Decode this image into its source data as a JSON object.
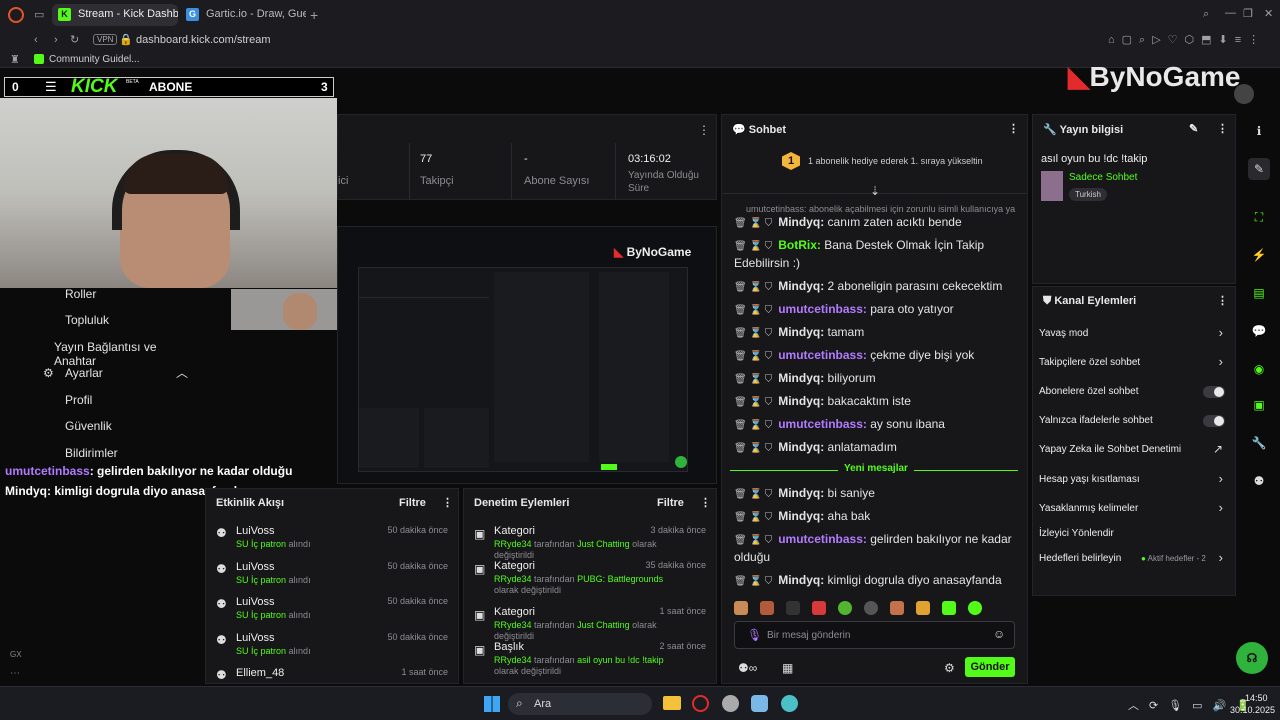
{
  "browser": {
    "tabs": [
      {
        "label": "Stream - Kick Dashboard",
        "active": true
      },
      {
        "label": "Gartic.io - Draw, Guess, W",
        "active": false
      }
    ],
    "url": "dashboard.kick.com/stream",
    "vpn": "VPN",
    "bookmark": "Community Guidel..."
  },
  "overlay": {
    "kick_logo": "KICK",
    "beta": "BETA",
    "abone_label": "ABONE",
    "abone_count": "3",
    "zero": "0",
    "brand": "ByNoGame"
  },
  "left_menu": {
    "items": [
      "Roller",
      "Topluluk",
      "Yayın Bağlantısı ve Anahtar",
      "Ayarlar",
      "Profil",
      "Güvenlik",
      "Bildirimler"
    ],
    "gx": "GX"
  },
  "overlay_chat": [
    {
      "user": "umutcetinbass",
      "text": ": gelirden bakılıyor ne kadar olduğu"
    },
    {
      "user": "Mindyq",
      "text": ": kimligi dogrula diyo anasayfanda"
    }
  ],
  "stats": [
    {
      "value": "",
      "label": "ici"
    },
    {
      "value": "77",
      "label": "Takipçi"
    },
    {
      "value": "-",
      "label": "Abone Sayısı"
    },
    {
      "value": "03:16:02",
      "label": "Yayında Olduğu Süre"
    }
  ],
  "activity": {
    "title": "Etkinlik Akışı",
    "filter": "Filtre",
    "items": [
      {
        "user": "LuiVoss",
        "detail": "SU İç patron",
        "suffix": "alındı",
        "time": "50 dakika önce"
      },
      {
        "user": "LuiVoss",
        "detail": "SU İç patron",
        "suffix": "alındı",
        "time": "50 dakika önce"
      },
      {
        "user": "LuiVoss",
        "detail": "SU İç patron",
        "suffix": "alındı",
        "time": "50 dakika önce"
      },
      {
        "user": "LuiVoss",
        "detail": "SU İç patron",
        "suffix": "alındı",
        "time": "50 dakika önce"
      },
      {
        "user": "Elliem_48",
        "detail": "",
        "suffix": "",
        "time": "1 saat önce"
      }
    ]
  },
  "moderation": {
    "title": "Denetim Eylemleri",
    "filter": "Filtre",
    "items": [
      {
        "title": "Kategori",
        "time": "3 dakika önce",
        "actor": "RRyde34",
        "mid": "tarafından",
        "value": "Just Chatting",
        "rest": "olarak değiştirildi"
      },
      {
        "title": "Kategori",
        "time": "35 dakika önce",
        "actor": "RRyde34",
        "mid": "tarafından",
        "value": "PUBG: Battlegrounds",
        "rest": "olarak değiştirildi"
      },
      {
        "title": "Kategori",
        "time": "1 saat önce",
        "actor": "RRyde34",
        "mid": "tarafından",
        "value": "Just Chatting",
        "rest": "olarak değiştirildi"
      },
      {
        "title": "Başlık",
        "time": "2 saat önce",
        "actor": "RRyde34",
        "mid": "tarafından",
        "value": "asil oyun bu !dc !takip",
        "rest": "olarak değiştirildi"
      }
    ]
  },
  "chat": {
    "title": "Sohbet",
    "pinned_badge": "1",
    "pinned": "1 abonelik hediye ederek 1. sıraya yükseltin",
    "system_line": "umutcetinbass: abonelik açabilmesi için zorunlu isimli kullanıcıya ya...",
    "messages": [
      {
        "user": "Mindyq",
        "text": "canım zaten acıktı bende",
        "color": "#e4e4e4"
      },
      {
        "user": "BotRix",
        "text": "Bana Destek Olmak İçin Takip Edebilirsin :)",
        "color": "#53fc18"
      },
      {
        "user": "Mindyq",
        "text": "2 aboneligin parasını cekecektim",
        "color": "#e4e4e4"
      },
      {
        "user": "umutcetinbass",
        "text": "para oto yatıyor",
        "color": "#b27bff"
      },
      {
        "user": "Mindyq",
        "text": "tamam",
        "color": "#e4e4e4"
      },
      {
        "user": "umutcetinbass",
        "text": "çekme diye bişi yok",
        "color": "#b27bff"
      },
      {
        "user": "Mindyq",
        "text": "biliyorum",
        "color": "#e4e4e4"
      },
      {
        "user": "Mindyq",
        "text": "bakacaktım iste",
        "color": "#e4e4e4"
      },
      {
        "user": "umutcetinbass",
        "text": "ay sonu ibana",
        "color": "#b27bff"
      },
      {
        "user": "Mindyq",
        "text": "anlatamadım",
        "color": "#e4e4e4"
      }
    ],
    "new_messages": "Yeni mesajlar",
    "messages2": [
      {
        "user": "Mindyq",
        "text": "bi saniye",
        "color": "#e4e4e4"
      },
      {
        "user": "Mindyq",
        "text": "aha bak",
        "color": "#e4e4e4"
      },
      {
        "user": "umutcetinbass",
        "text": "gelirden bakılıyor ne kadar olduğu",
        "color": "#b27bff"
      },
      {
        "user": "Mindyq",
        "text": "kimligi dogrula diyo anasayfanda",
        "color": "#e4e4e4"
      }
    ],
    "input_placeholder": "Bir mesaj gönderin",
    "send": "Gönder"
  },
  "stream_info": {
    "title": "Yayın bilgisi",
    "stream_title": "asıl oyun bu !dc !takip",
    "category": "Sadece Sohbet",
    "language": "Turkish"
  },
  "channel_actions": {
    "title": "Kanal Eylemleri",
    "items": [
      {
        "label": "Yavaş mod",
        "control": "chevron"
      },
      {
        "label": "Takipçilere özel sohbet",
        "control": "chevron"
      },
      {
        "label": "Abonelere özel sohbet",
        "control": "toggle"
      },
      {
        "label": "Yalnızca ifadelerle sohbet",
        "control": "toggle"
      },
      {
        "label": "Yapay Zeka ile Sohbet Denetimi",
        "control": "external"
      },
      {
        "label": "Hesap yaşı kısıtlaması",
        "control": "chevron"
      },
      {
        "label": "Yasaklanmış kelimeler",
        "control": "chevron"
      },
      {
        "label": "İzleyici Yönlendir",
        "control": "none"
      },
      {
        "label": "Hedefleri belirleyin",
        "control": "chevron"
      }
    ],
    "goals_badge": "Aktif hedefler - 2"
  },
  "taskbar": {
    "search": "Ara",
    "time": "14:50",
    "date": "30.10.2025"
  },
  "colors": {
    "accent": "#53fc18",
    "purple": "#b27bff"
  }
}
